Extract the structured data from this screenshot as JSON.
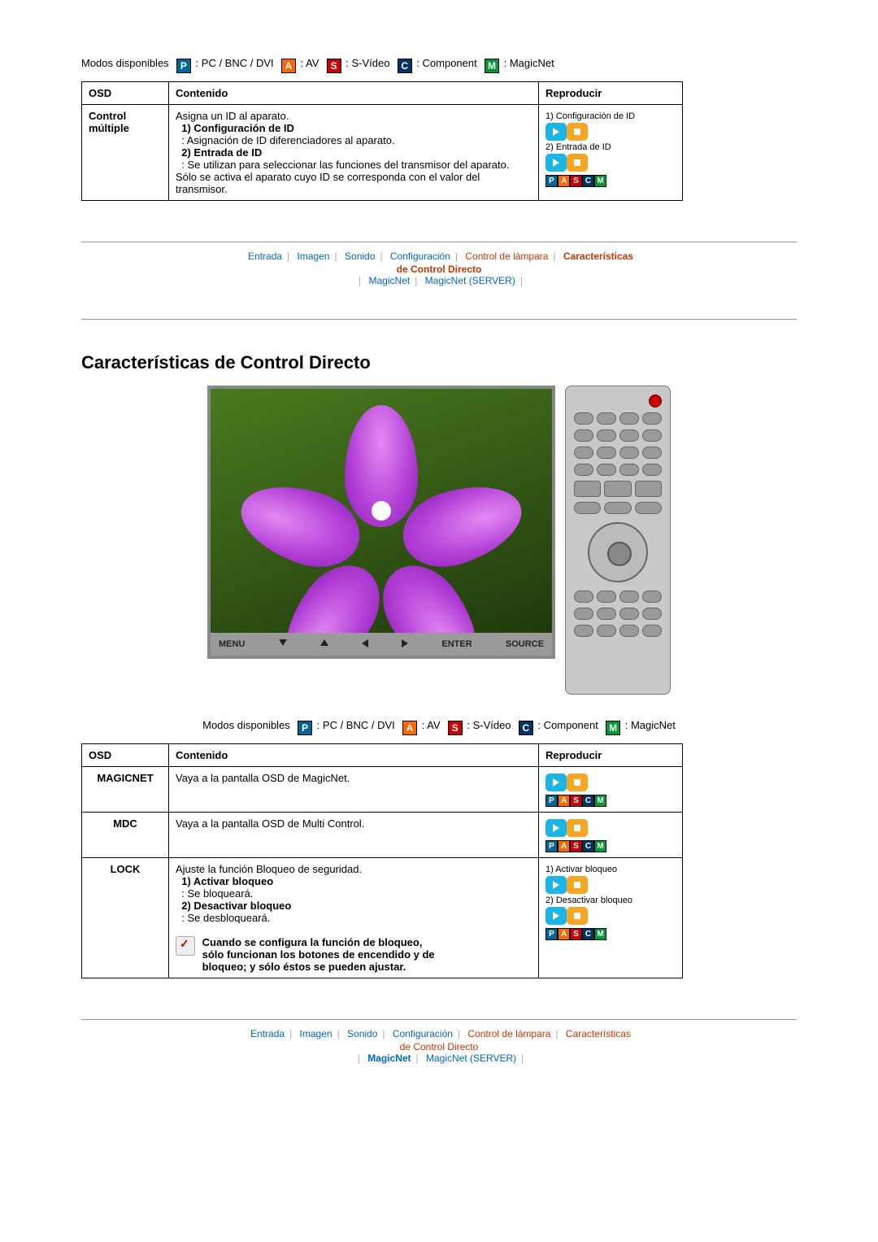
{
  "modes": {
    "label": "Modos disponibles",
    "p": ": PC / BNC / DVI",
    "a": ": AV",
    "s": ": S-Vídeo",
    "c": ": Component",
    "m": ": MagicNet"
  },
  "table1": {
    "h_osd": "OSD",
    "h_content": "Contenido",
    "h_play": "Reproducir",
    "r1_osd": "Control múltiple",
    "r1_l1": "Asigna un ID al aparato.",
    "r1_b1": "1) Configuración de ID",
    "r1_d1": ": Asignación de ID diferenciadores al aparato.",
    "r1_b2": "2) Entrada de ID",
    "r1_d2": ": Se utilizan para seleccionar las funciones del transmisor del aparato. Sólo se activa el aparato cuyo ID se corresponda con el valor del transmisor.",
    "r1_p1": "1) Configuración de ID",
    "r1_p2": "2) Entrada de ID"
  },
  "nav": {
    "n1": "Entrada",
    "n2": "Imagen",
    "n3": "Sonido",
    "n4": "Configuración",
    "n5": "Control de lámpara",
    "n6": "Características",
    "n6s": "de Control Directo",
    "n7": "MagicNet",
    "n8": "MagicNet (SERVER)"
  },
  "pageTitle": "Características de Control Directo",
  "tvbar": {
    "menu": "MENU",
    "enter": "ENTER",
    "source": "SOURCE"
  },
  "table2": {
    "h_osd": "OSD",
    "h_content": "Contenido",
    "h_play": "Reproducir",
    "r1_osd": "MAGICNET",
    "r1_c": "Vaya a la pantalla OSD de MagicNet.",
    "r2_osd": "MDC",
    "r2_c": "Vaya a la pantalla OSD de Multi Control.",
    "r3_osd": "LOCK",
    "r3_l1": "Ajuste la función Bloqueo de seguridad.",
    "r3_b1": "1) Activar bloqueo",
    "r3_d1": ": Se bloqueará.",
    "r3_b2": "2) Desactivar bloqueo",
    "r3_d2": ": Se desbloqueará.",
    "r3_note": "Cuando se configura la función de bloqueo, sólo funcionan los botones de encendido y de bloqueo; y sólo éstos se pueden ajustar.",
    "r3_p1": "1) Activar bloqueo",
    "r3_p2": "2) Desactivar bloqueo"
  }
}
